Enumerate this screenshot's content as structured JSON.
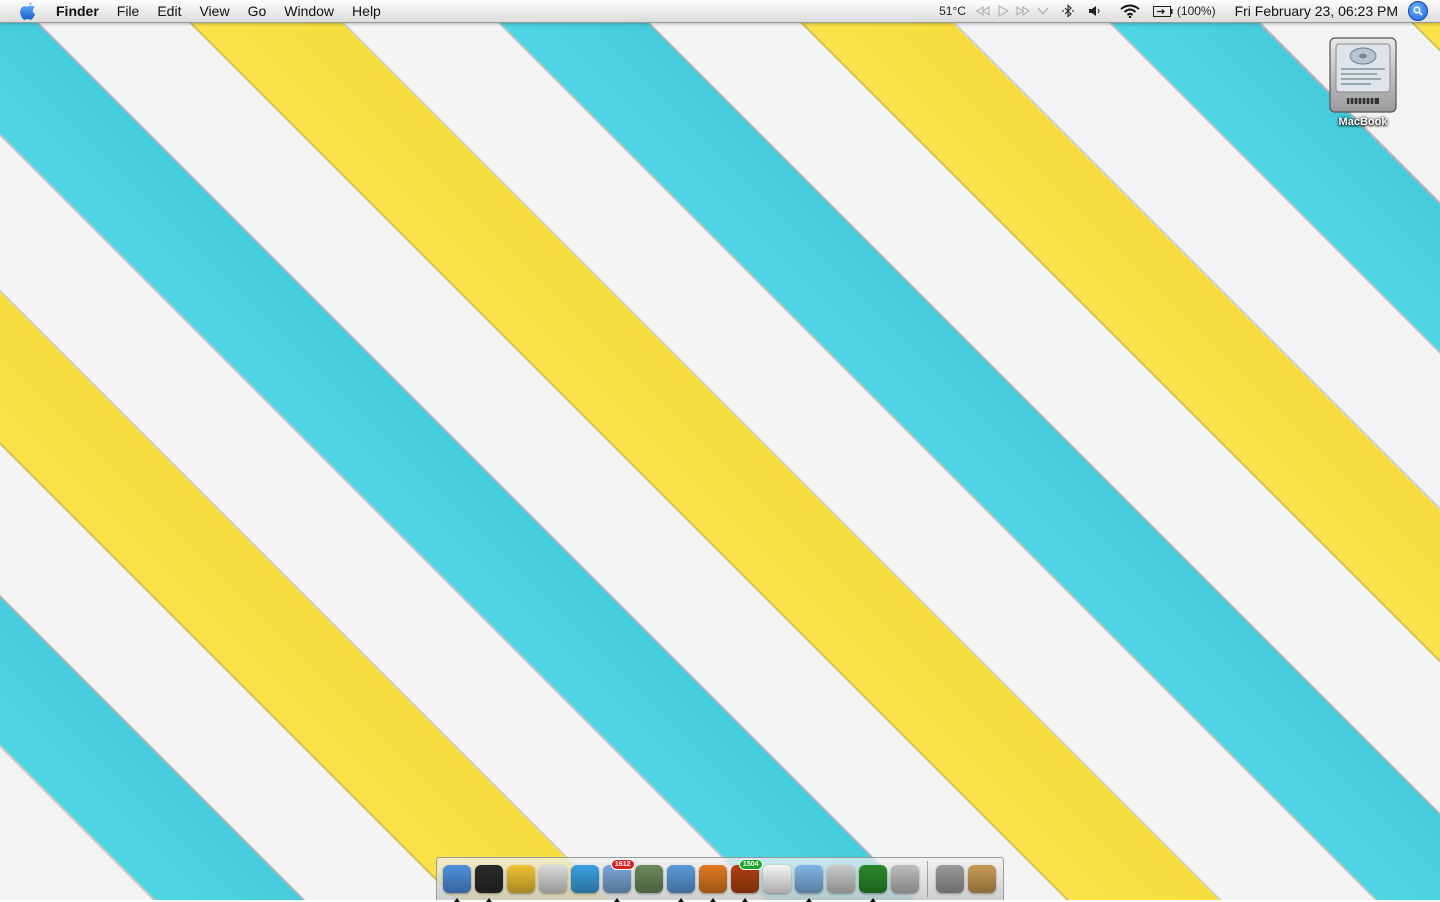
{
  "menubar": {
    "app_name": "Finder",
    "menus": [
      "File",
      "Edit",
      "View",
      "Go",
      "Window",
      "Help"
    ],
    "temperature": "51°C",
    "battery": "(100%)",
    "clock": "Fri February 23, 06:23 PM"
  },
  "desktop": {
    "icons": [
      {
        "label": "MacBook",
        "icon": "hard-drive-icon"
      }
    ]
  },
  "dock": {
    "apps": [
      {
        "icon": "finder-icon",
        "color": "#4f8fe0",
        "running": true
      },
      {
        "icon": "dashboard-icon",
        "color": "#2a2a2a",
        "running": true
      },
      {
        "icon": "growl-icon",
        "color": "#f1c232",
        "running": false
      },
      {
        "icon": "automator-icon",
        "color": "#d9d9d9",
        "running": false
      },
      {
        "icon": "quicktime-icon",
        "color": "#3aa0e0",
        "running": false
      },
      {
        "icon": "mail-icon",
        "color": "#7aa6d8",
        "running": true,
        "badge": "1612",
        "badge_color": "#d82020"
      },
      {
        "icon": "iphoto-icon",
        "color": "#6a8a5a",
        "running": false
      },
      {
        "icon": "safari-icon",
        "color": "#5b9ad9",
        "running": true
      },
      {
        "icon": "firefox-icon",
        "color": "#e07a1e",
        "running": true
      },
      {
        "icon": "vienna-icon",
        "color": "#b04010",
        "running": true,
        "badge": "1504",
        "badge_color": "#1aa62a"
      },
      {
        "icon": "textedit-icon",
        "color": "#f5f5f5",
        "running": false
      },
      {
        "icon": "itunes-icon",
        "color": "#7fb4e8",
        "running": true
      },
      {
        "icon": "dvd-player-icon",
        "color": "#c9c9c9",
        "running": false
      },
      {
        "icon": "x11-icon",
        "color": "#2a8a2a",
        "running": true
      },
      {
        "icon": "system-preferences-icon",
        "color": "#bdbdbd",
        "running": false
      }
    ],
    "docs": [
      {
        "icon": "downloads-stack-icon",
        "color": "#9a9a9a"
      },
      {
        "icon": "trash-box-icon",
        "color": "#c99a55"
      }
    ]
  }
}
